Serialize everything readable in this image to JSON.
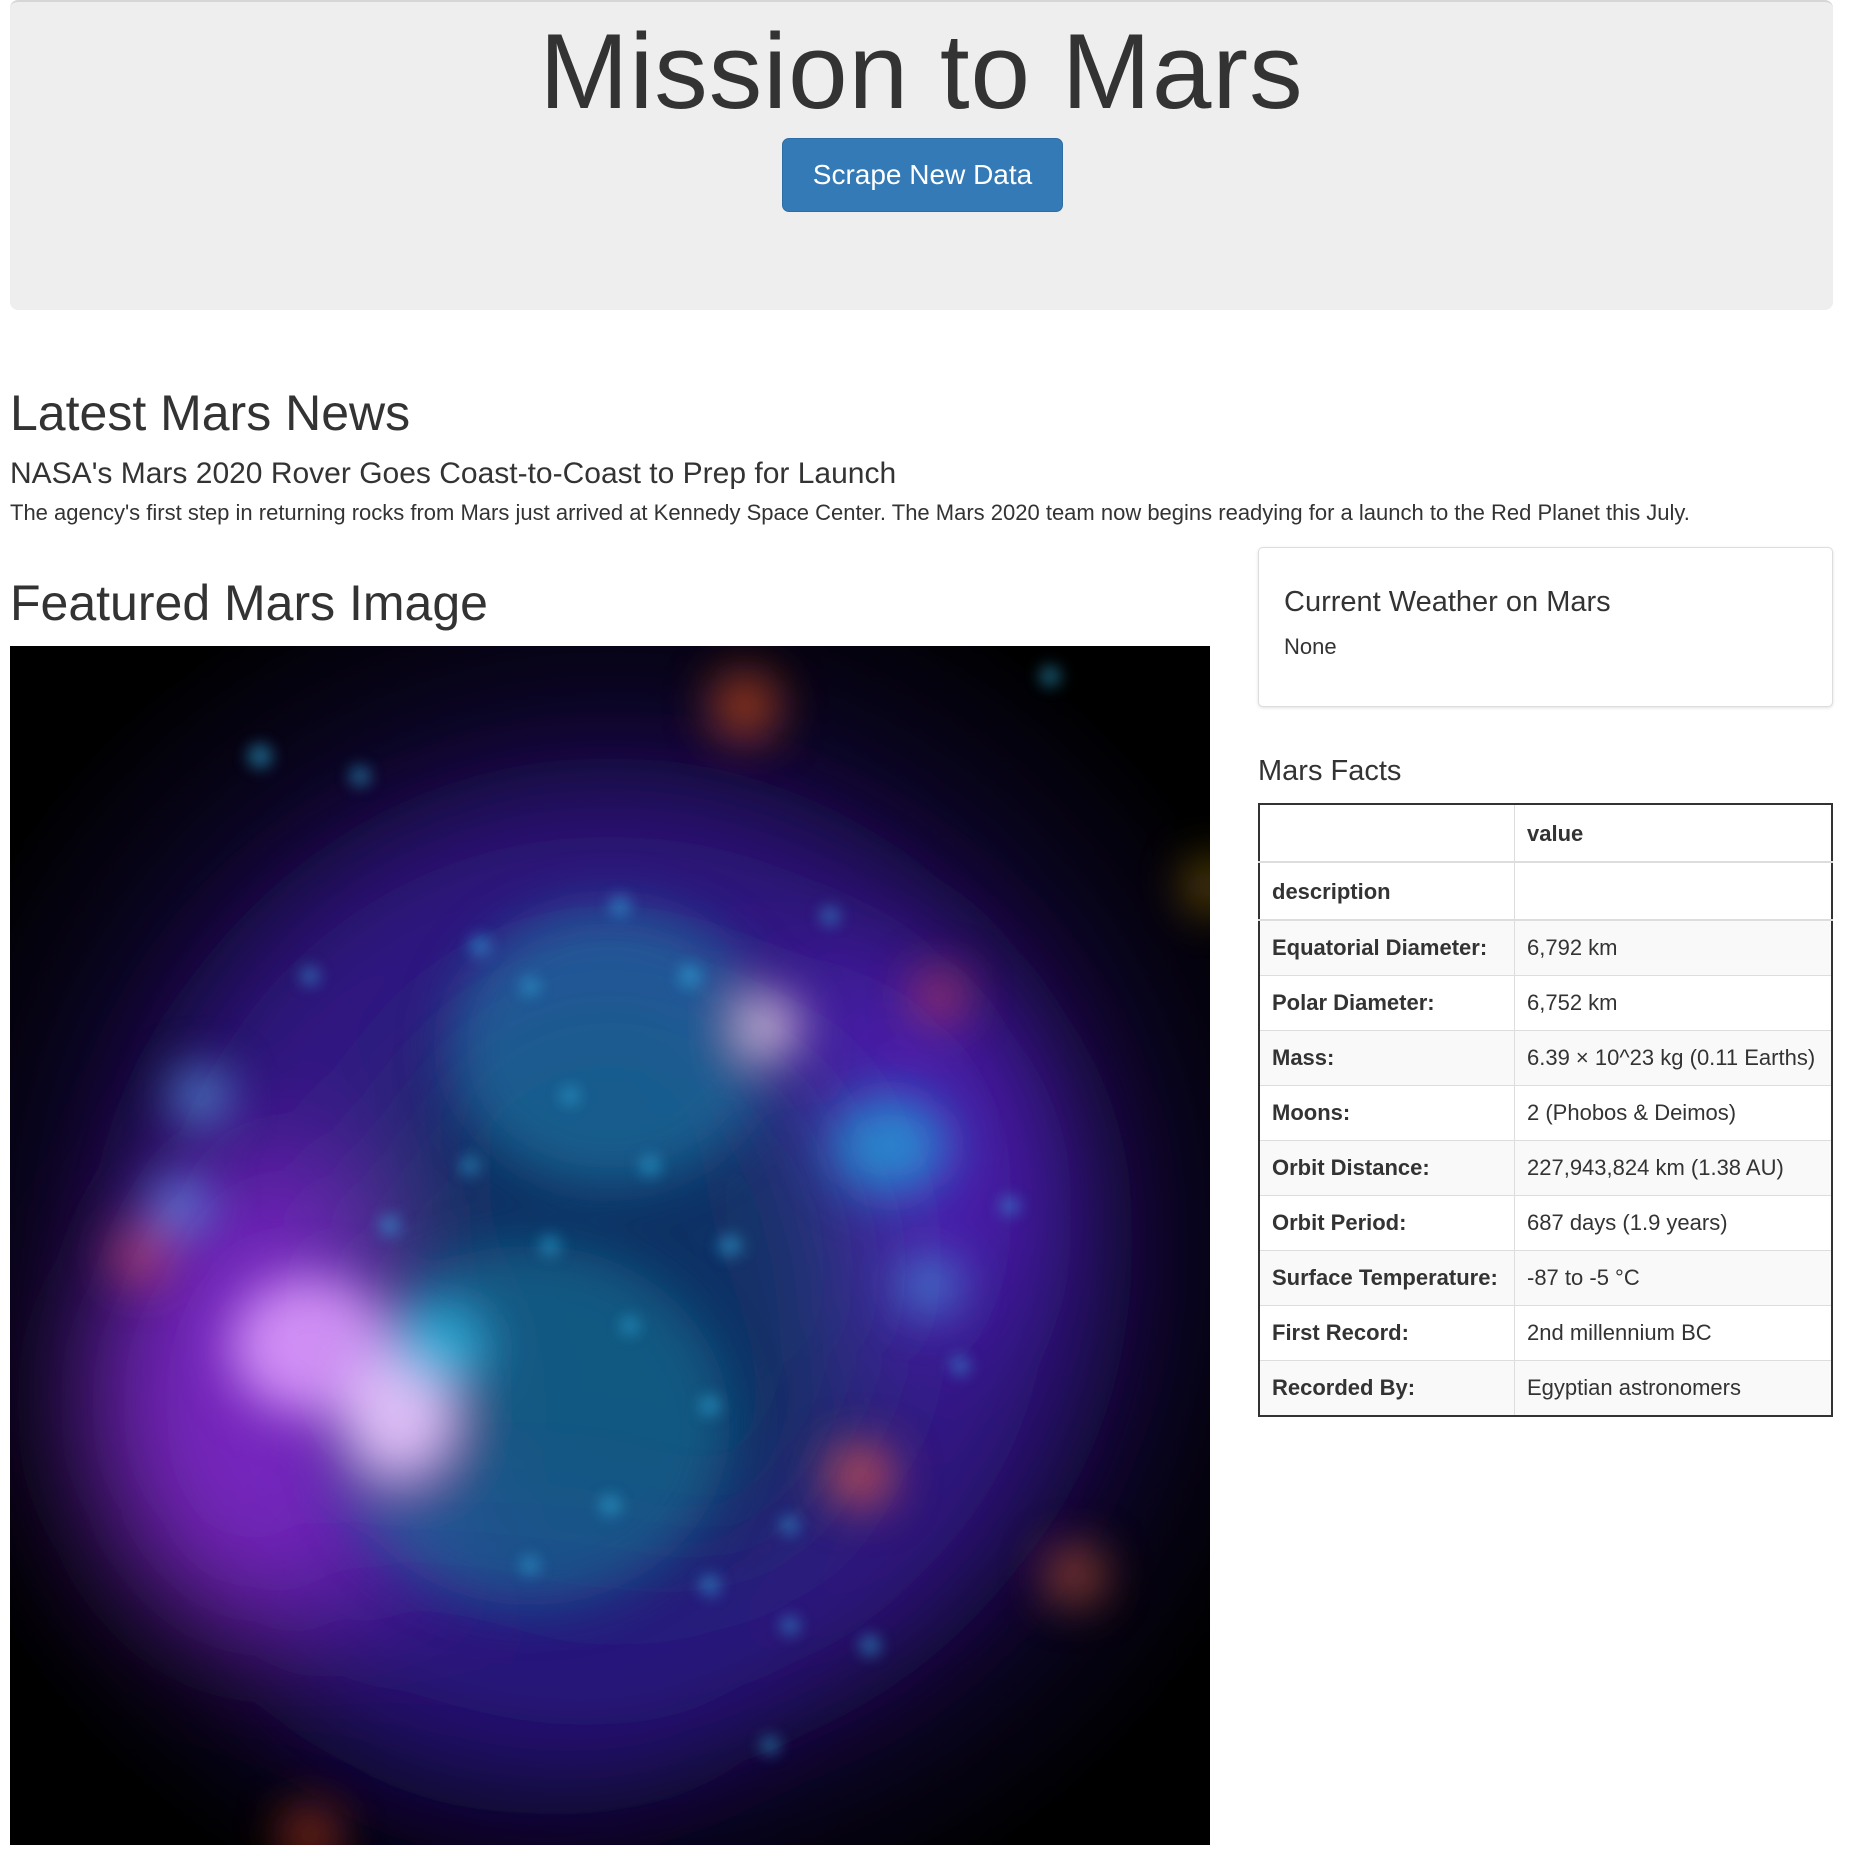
{
  "header": {
    "title": "Mission to Mars",
    "scrape_button_label": "Scrape New Data"
  },
  "news": {
    "heading": "Latest Mars News",
    "title": "NASA's Mars 2020 Rover Goes Coast-to-Coast to Prep for Launch",
    "teaser": "The agency's first step in returning rocks from Mars just arrived at Kennedy Space Center. The Mars 2020 team now begins readying for a launch to the Red Planet this July."
  },
  "featured": {
    "heading": "Featured Mars Image"
  },
  "weather": {
    "title": "Current Weather on Mars",
    "value": "None"
  },
  "facts": {
    "heading": "Mars Facts",
    "header_blank": "",
    "header_value": "value",
    "index_label": "description",
    "rows": [
      {
        "key": "Equatorial Diameter:",
        "value": "6,792 km"
      },
      {
        "key": "Polar Diameter:",
        "value": "6,752 km"
      },
      {
        "key": "Mass:",
        "value": "6.39 × 10^23 kg (0.11 Earths)"
      },
      {
        "key": "Moons:",
        "value": "2 (Phobos & Deimos)"
      },
      {
        "key": "Orbit Distance:",
        "value": "227,943,824 km (1.38 AU)"
      },
      {
        "key": "Orbit Period:",
        "value": "687 days (1.9 years)"
      },
      {
        "key": "Surface Temperature:",
        "value": "-87 to -5 °C"
      },
      {
        "key": "First Record:",
        "value": "2nd millennium BC"
      },
      {
        "key": "Recorded By:",
        "value": "Egyptian astronomers"
      }
    ]
  },
  "colors": {
    "primary_button": "#337ab7",
    "jumbotron_bg": "#eeeeee"
  }
}
